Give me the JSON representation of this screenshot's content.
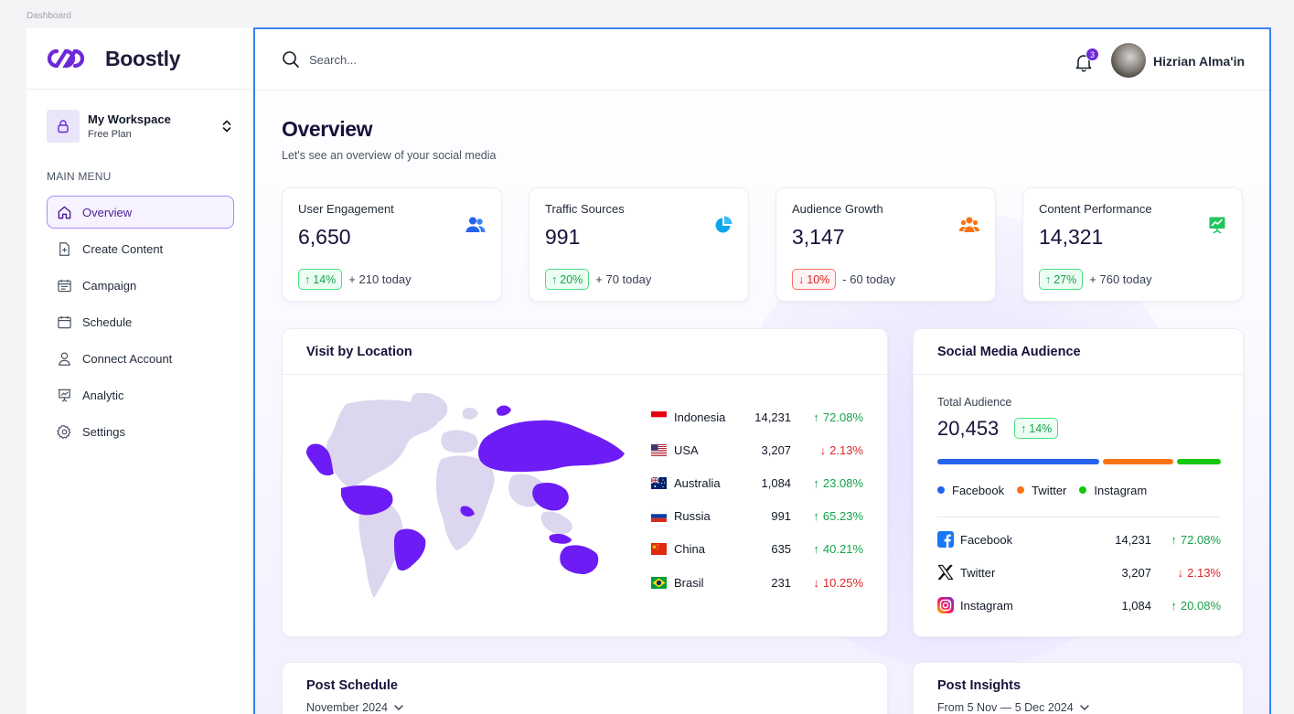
{
  "frame_label": "Dashboard",
  "brand": {
    "name": "Boostly",
    "accent": "#6d28d9"
  },
  "workspace": {
    "name": "My Workspace",
    "plan": "Free Plan"
  },
  "sidebar": {
    "section_title": "MAIN MENU",
    "items": [
      {
        "label": "Overview",
        "icon": "home-icon",
        "active": true
      },
      {
        "label": "Create Content",
        "icon": "file-plus-icon"
      },
      {
        "label": "Campaign",
        "icon": "calendar-list-icon"
      },
      {
        "label": "Schedule",
        "icon": "calendar-icon"
      },
      {
        "label": "Connect Account",
        "icon": "user-icon"
      },
      {
        "label": "Analytic",
        "icon": "presentation-chart-icon"
      },
      {
        "label": "Settings",
        "icon": "gear-icon"
      }
    ]
  },
  "header": {
    "search_placeholder": "Search...",
    "notification_count": "3",
    "user_name": "Hizrian Alma'in"
  },
  "page": {
    "title": "Overview",
    "subtitle": "Let's see an overview of your social media"
  },
  "stats": [
    {
      "label": "User Engagement",
      "value": "6,650",
      "change": "14%",
      "direction": "up",
      "today": "+ 210 today",
      "icon": "users-icon",
      "icon_color": "#2563eb"
    },
    {
      "label": "Traffic Sources",
      "value": "991",
      "change": "20%",
      "direction": "up",
      "today": "+ 70 today",
      "icon": "pie-chart-icon",
      "icon_color": "#0ea5e9"
    },
    {
      "label": "Audience Growth",
      "value": "3,147",
      "change": "10%",
      "direction": "down",
      "today": "- 60 today",
      "icon": "group-icon",
      "icon_color": "#f97316"
    },
    {
      "label": "Content Performance",
      "value": "14,321",
      "change": "27%",
      "direction": "up",
      "today": "+ 760 today",
      "icon": "trend-board-icon",
      "icon_color": "#22c55e"
    }
  ],
  "visit_by_location": {
    "title": "Visit by Location",
    "rows": [
      {
        "country": "Indonesia",
        "value": "14,231",
        "change": "72.08%",
        "direction": "up",
        "flag": "id-flag-icon"
      },
      {
        "country": "USA",
        "value": "3,207",
        "change": "2.13%",
        "direction": "down",
        "flag": "us-flag-icon"
      },
      {
        "country": "Australia",
        "value": "1,084",
        "change": "23.08%",
        "direction": "up",
        "flag": "au-flag-icon"
      },
      {
        "country": "Russia",
        "value": "991",
        "change": "65.23%",
        "direction": "up",
        "flag": "ru-flag-icon"
      },
      {
        "country": "China",
        "value": "635",
        "change": "40.21%",
        "direction": "up",
        "flag": "cn-flag-icon"
      },
      {
        "country": "Brasil",
        "value": "231",
        "change": "10.25%",
        "direction": "down",
        "flag": "br-flag-icon"
      }
    ]
  },
  "social_audience": {
    "title": "Social Media Audience",
    "total_label": "Total Audience",
    "total_value": "20,453",
    "total_change": "14%",
    "legend": [
      {
        "name": "Facebook",
        "color": "#2563eb"
      },
      {
        "name": "Twitter",
        "color": "#f97316"
      },
      {
        "name": "Instagram",
        "color": "#16c60c"
      }
    ],
    "rows": [
      {
        "name": "Facebook",
        "value": "14,231",
        "change": "72.08%",
        "direction": "up",
        "icon": "facebook-icon"
      },
      {
        "name": "Twitter",
        "value": "3,207",
        "change": "2.13%",
        "direction": "down",
        "icon": "x-twitter-icon"
      },
      {
        "name": "Instagram",
        "value": "1,084",
        "change": "20.08%",
        "direction": "up",
        "icon": "instagram-icon"
      }
    ]
  },
  "post_schedule": {
    "title": "Post Schedule",
    "period": "November 2024"
  },
  "post_insights": {
    "title": "Post Insights",
    "period": "From 5 Nov — 5 Dec 2024"
  }
}
